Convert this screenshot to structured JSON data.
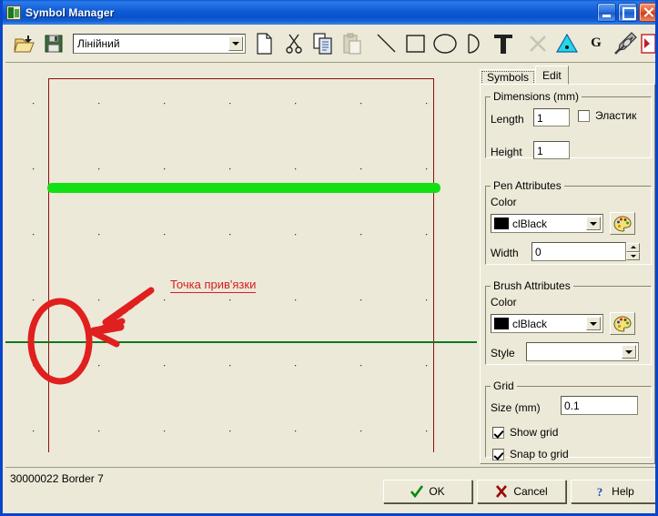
{
  "window": {
    "title": "Symbol Manager",
    "icon": "app-icon",
    "controls": {
      "minimize": "Minimize",
      "maximize": "Maximize",
      "close": "Close"
    }
  },
  "toolbar": {
    "symbol_combo": {
      "value": "Лінійний",
      "placeholder": ""
    },
    "icons": [
      {
        "name": "open-icon",
        "title": "Open"
      },
      {
        "name": "save-icon",
        "title": "Save"
      },
      {
        "name": "new-icon",
        "title": "New"
      },
      {
        "name": "cut-icon",
        "title": "Cut"
      },
      {
        "name": "copy-icon",
        "title": "Copy"
      },
      {
        "name": "paste-icon",
        "title": "Paste"
      },
      {
        "name": "line-tool-icon",
        "title": "Line"
      },
      {
        "name": "rectangle-tool-icon",
        "title": "Rectangle"
      },
      {
        "name": "ellipse-tool-icon",
        "title": "Ellipse"
      },
      {
        "name": "arc-tool-icon",
        "title": "Arc"
      },
      {
        "name": "text-tool-icon",
        "title": "Text"
      },
      {
        "name": "delete-icon",
        "title": "Delete"
      },
      {
        "name": "triangle-icon",
        "title": "Triangle"
      },
      {
        "name": "group-icon",
        "title": "G"
      },
      {
        "name": "pen-tool-icon",
        "title": "Pen"
      },
      {
        "name": "edit-symbol-icon",
        "title": "Edit"
      }
    ],
    "group_label": "G"
  },
  "canvas": {
    "annotation_text": "Точка прив'язки",
    "objects": {
      "selected_line": "green-line-object",
      "border": "symbol-border-rectangle",
      "axis": "origin-axis-line"
    }
  },
  "panel": {
    "tabs": [
      {
        "label": "Symbols",
        "active": false
      },
      {
        "label": "Edit",
        "active": true
      }
    ],
    "dimensions": {
      "legend": "Dimensions (mm)",
      "length_label": "Length",
      "length_value": "1",
      "height_label": "Height",
      "height_value": "1",
      "elastic_label": "Эластик",
      "elastic_checked": false
    },
    "pen": {
      "legend": "Pen Attributes",
      "color_label": "Color",
      "color_value": "clBlack",
      "color_hex": "#000000",
      "width_label": "Width",
      "width_value": "0",
      "palette_button": "palette-icon"
    },
    "brush": {
      "legend": "Brush Attributes",
      "color_label": "Color",
      "color_value": "clBlack",
      "color_hex": "#000000",
      "style_label": "Style",
      "style_value": "",
      "palette_button": "palette-icon"
    },
    "grid": {
      "legend": "Grid",
      "size_label": "Size (mm)",
      "size_value": "0.1",
      "show_grid_label": "Show grid",
      "show_grid_checked": true,
      "snap_grid_label": "Snap to grid",
      "snap_grid_checked": true
    }
  },
  "status": {
    "text": "30000022 Border 7"
  },
  "buttons": {
    "ok": "OK",
    "cancel": "Cancel",
    "help": "Help"
  },
  "colors": {
    "titlebar_blue": "#0b52cc",
    "face": "#ece9d8",
    "canvas_bg": "#ece9d8",
    "selection_green": "#12e012",
    "axis_green": "#0a7a1e",
    "border_red": "#8c1010",
    "annotation_red": "#d42020"
  }
}
